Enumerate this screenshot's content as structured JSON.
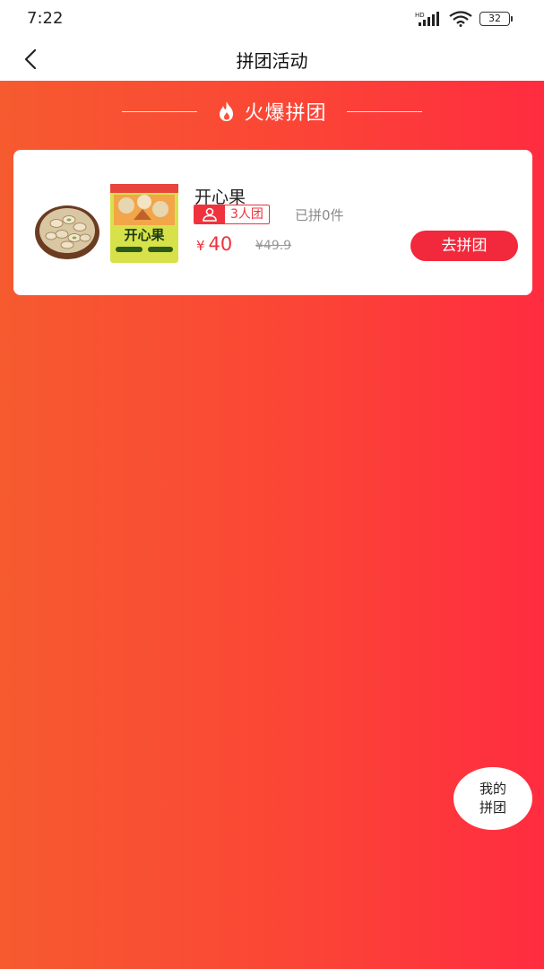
{
  "status_bar": {
    "time": "7:22",
    "network": "HD",
    "battery": "32"
  },
  "nav": {
    "title": "拼团活动",
    "back_icon": "chevron-left-icon"
  },
  "section": {
    "title": "火爆拼团",
    "icon": "flame-icon"
  },
  "product": {
    "name": "开心果",
    "group_size_label": "3人团",
    "joined_label": "已拼0件",
    "currency": "¥",
    "price": "40",
    "original_price": "¥49.9",
    "join_button_label": "去拼团",
    "package_text": "开心果"
  },
  "floating": {
    "line1": "我的",
    "line2": "拼团"
  },
  "colors": {
    "accent": "#f0323c",
    "gradient_start": "#f65a2f",
    "gradient_end": "#ff2c40"
  }
}
